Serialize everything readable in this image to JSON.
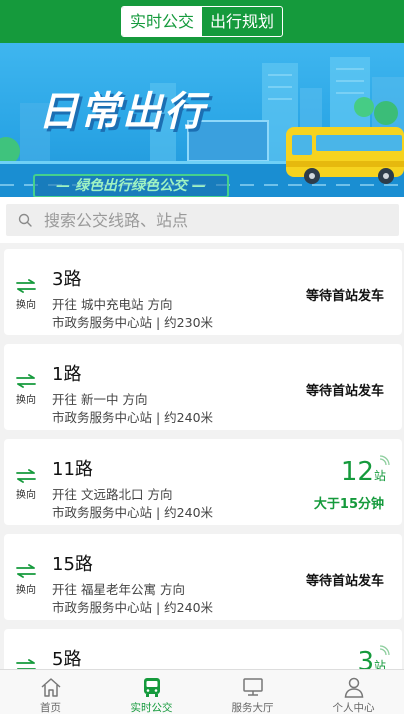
{
  "header": {
    "tabs": [
      {
        "label": "实时公交",
        "active": true
      },
      {
        "label": "出行规划",
        "active": false
      }
    ]
  },
  "banner": {
    "title": "日常出行",
    "subtitle": "— 绿色出行绿色公交 —"
  },
  "search": {
    "placeholder": "搜索公交线路、站点"
  },
  "swap_label": "换向",
  "routes": [
    {
      "name": "3路",
      "direction": "开往 城中充电站 方向",
      "stop": "市政务服务中心站 | 约230米",
      "status": "等待首站发车"
    },
    {
      "name": "1路",
      "direction": "开往 新一中 方向",
      "stop": "市政务服务中心站 | 约240米",
      "status": "等待首站发车"
    },
    {
      "name": "11路",
      "direction": "开往 文远路北口 方向",
      "stop": "市政务服务中心站 | 约240米",
      "eta_stops": "12",
      "eta_unit": "站",
      "eta_time": "大于15分钟"
    },
    {
      "name": "15路",
      "direction": "开往 福星老年公寓 方向",
      "stop": "市政务服务中心站 | 约240米",
      "status": "等待首站发车"
    },
    {
      "name": "5路",
      "eta_stops": "3",
      "eta_unit": "站"
    }
  ],
  "nav": [
    {
      "label": "首页",
      "icon": "home-icon"
    },
    {
      "label": "实时公交",
      "icon": "bus-icon",
      "active": true
    },
    {
      "label": "服务大厅",
      "icon": "monitor-icon"
    },
    {
      "label": "个人中心",
      "icon": "user-icon"
    }
  ],
  "colors": {
    "brand_green": "#159a3c",
    "banner_blue": "#2ba6e6"
  }
}
